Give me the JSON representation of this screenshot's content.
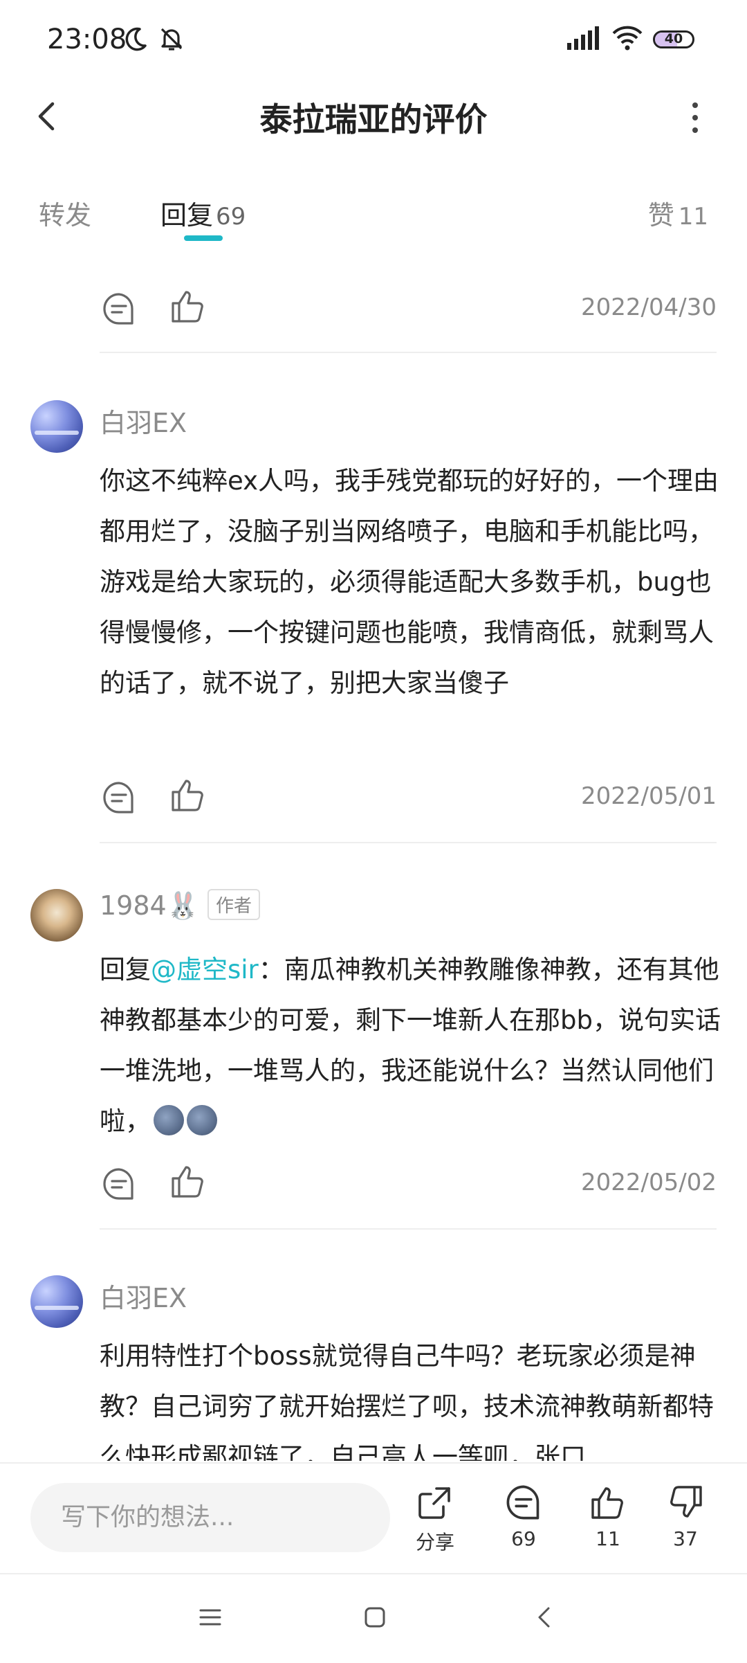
{
  "status": {
    "time": "23:08",
    "battery": "40"
  },
  "header": {
    "title": "泰拉瑞亚的评价"
  },
  "tabs": {
    "forward": "转发",
    "reply": "回复",
    "reply_count": "69",
    "like": "赞",
    "like_count": "11"
  },
  "first_item": {
    "date": "2022/04/30"
  },
  "comments": [
    {
      "username": "白羽EX",
      "body": "你这不纯粹ex人吗，我手残党都玩的好好的，一个理由都用烂了，没脑子别当网络喷子，电脑和手机能比吗，游戏是给大家玩的，必须得能适配大多数手机，bug也得慢慢修，一个按键问题也能喷，我情商低，就剩骂人的话了，就不说了，别把大家当傻子",
      "date": "2022/05/01"
    },
    {
      "username": "1984🐰",
      "badge": "作者",
      "reply_prefix": "回复",
      "mention": "@虚空sir",
      "body": "：南瓜神教机关神教雕像神教，还有其他神教都基本少的可爱，剩下一堆新人在那bb，说句实话一堆洗地，一堆骂人的，我还能说什么？当然认同他们啦，",
      "date": "2022/05/02"
    },
    {
      "username": "白羽EX",
      "body": "利用特性打个boss就觉得自己牛吗？老玩家必须是神教？自己词穷了就开始摆烂了呗，技术流神教萌新都特么快形成鄙视链了，自己高人一等呗，张口"
    }
  ],
  "bottom": {
    "input_placeholder": "写下你的想法...",
    "share_label": "分享",
    "comment_count": "69",
    "like_count": "11",
    "dislike_count": "37"
  },
  "colors": {
    "accent": "#1fb8c7",
    "muted": "#8a8a8a",
    "text": "#222222"
  },
  "icons": [
    "moon-icon",
    "bell-off-icon",
    "signal-icon",
    "wifi-icon",
    "battery-icon",
    "back-arrow-icon",
    "more-vertical-icon",
    "comment-icon",
    "thumbs-up-icon",
    "share-icon",
    "thumbs-down-icon",
    "nav-menu-icon",
    "nav-home-icon",
    "nav-back-icon"
  ]
}
